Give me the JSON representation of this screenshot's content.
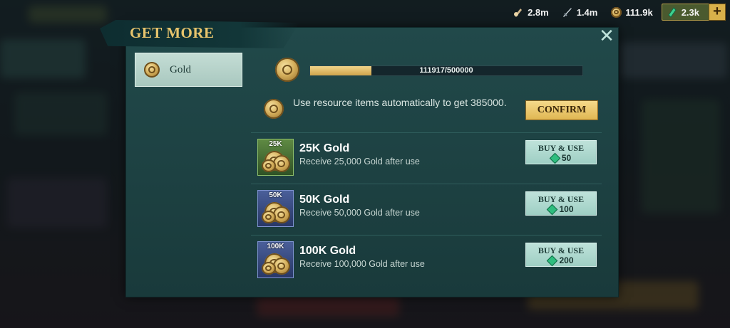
{
  "resources": [
    {
      "icon": "potion-icon",
      "value": "2.8m"
    },
    {
      "icon": "sword-icon",
      "value": "1.4m"
    },
    {
      "icon": "gold-coin-icon",
      "value": "111.9k"
    },
    {
      "icon": "gem-icon",
      "value": "2.3k"
    }
  ],
  "dialog": {
    "title": "GET MORE",
    "tab_label": "Gold",
    "progress": {
      "current": 111917,
      "max": 500000,
      "text": "111917/500000"
    },
    "auto_text": "Use resource items automatically to get 385000.",
    "confirm_label": "CONFIRM"
  },
  "items": [
    {
      "tag": "25K",
      "name": "25K Gold",
      "desc": "Receive 25,000 Gold after use",
      "buy_label": "BUY & USE",
      "price": "50",
      "frame": "green"
    },
    {
      "tag": "50K",
      "name": "50K Gold",
      "desc": "Receive 50,000 Gold after use",
      "buy_label": "BUY & USE",
      "price": "100",
      "frame": "blue"
    },
    {
      "tag": "100K",
      "name": "100K Gold",
      "desc": "Receive 100,000 Gold after use",
      "buy_label": "BUY & USE",
      "price": "200",
      "frame": "blue"
    }
  ],
  "colors": {
    "accent_gold": "#e7c46c",
    "panel": "#1d4142",
    "button_teal": "#9fcfc4",
    "button_gold": "#e0b753"
  }
}
